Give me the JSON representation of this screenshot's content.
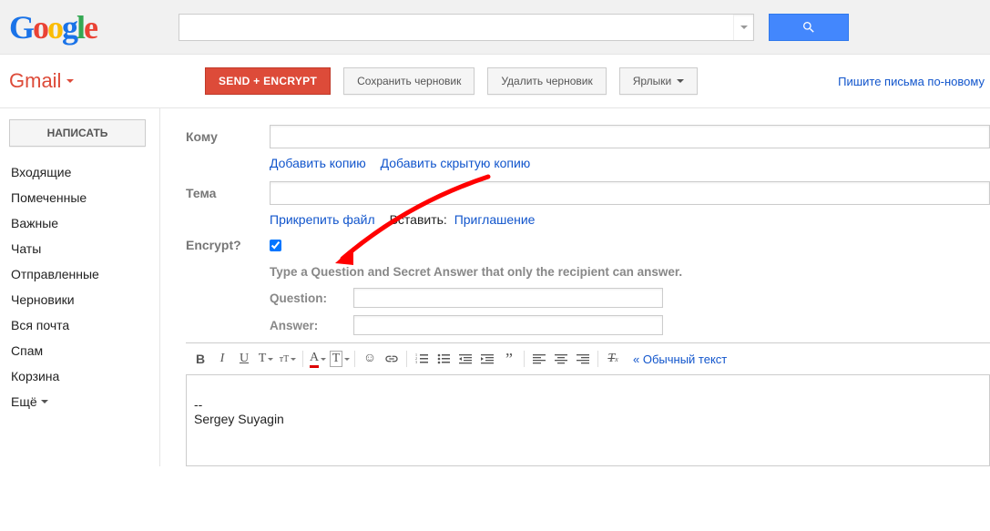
{
  "topbar": {
    "logo_letters": [
      "G",
      "o",
      "o",
      "g",
      "l",
      "e"
    ],
    "search_value": ""
  },
  "brand": "Gmail",
  "toolbar": {
    "send": "SEND + ENCRYPT",
    "save_draft": "Сохранить черновик",
    "delete_draft": "Удалить черновик",
    "labels": "Ярлыки",
    "new_compose_link": "Пишите письма по-новому"
  },
  "sidebar": {
    "compose": "НАПИСАТЬ",
    "items": [
      "Входящие",
      "Помеченные",
      "Важные",
      "Чаты",
      "Отправленные",
      "Черновики",
      "Вся почта",
      "Спам",
      "Корзина"
    ],
    "more": "Ещё"
  },
  "compose": {
    "to_label": "Кому",
    "add_cc": "Добавить копию",
    "add_bcc": "Добавить скрытую копию",
    "subject_label": "Тема",
    "attach": "Прикрепить файл",
    "insert_label": "Вставить:",
    "insert_invite": "Приглашение",
    "encrypt_label": "Encrypt?",
    "encrypt_checked": true,
    "encrypt_hint": "Type a Question and Secret Answer that only the recipient can answer.",
    "question_label": "Question:",
    "answer_label": "Answer:",
    "plain_text": "« Обычный текст",
    "body_signature_sep": "--",
    "body_signature": "Sergey Suyagin"
  }
}
